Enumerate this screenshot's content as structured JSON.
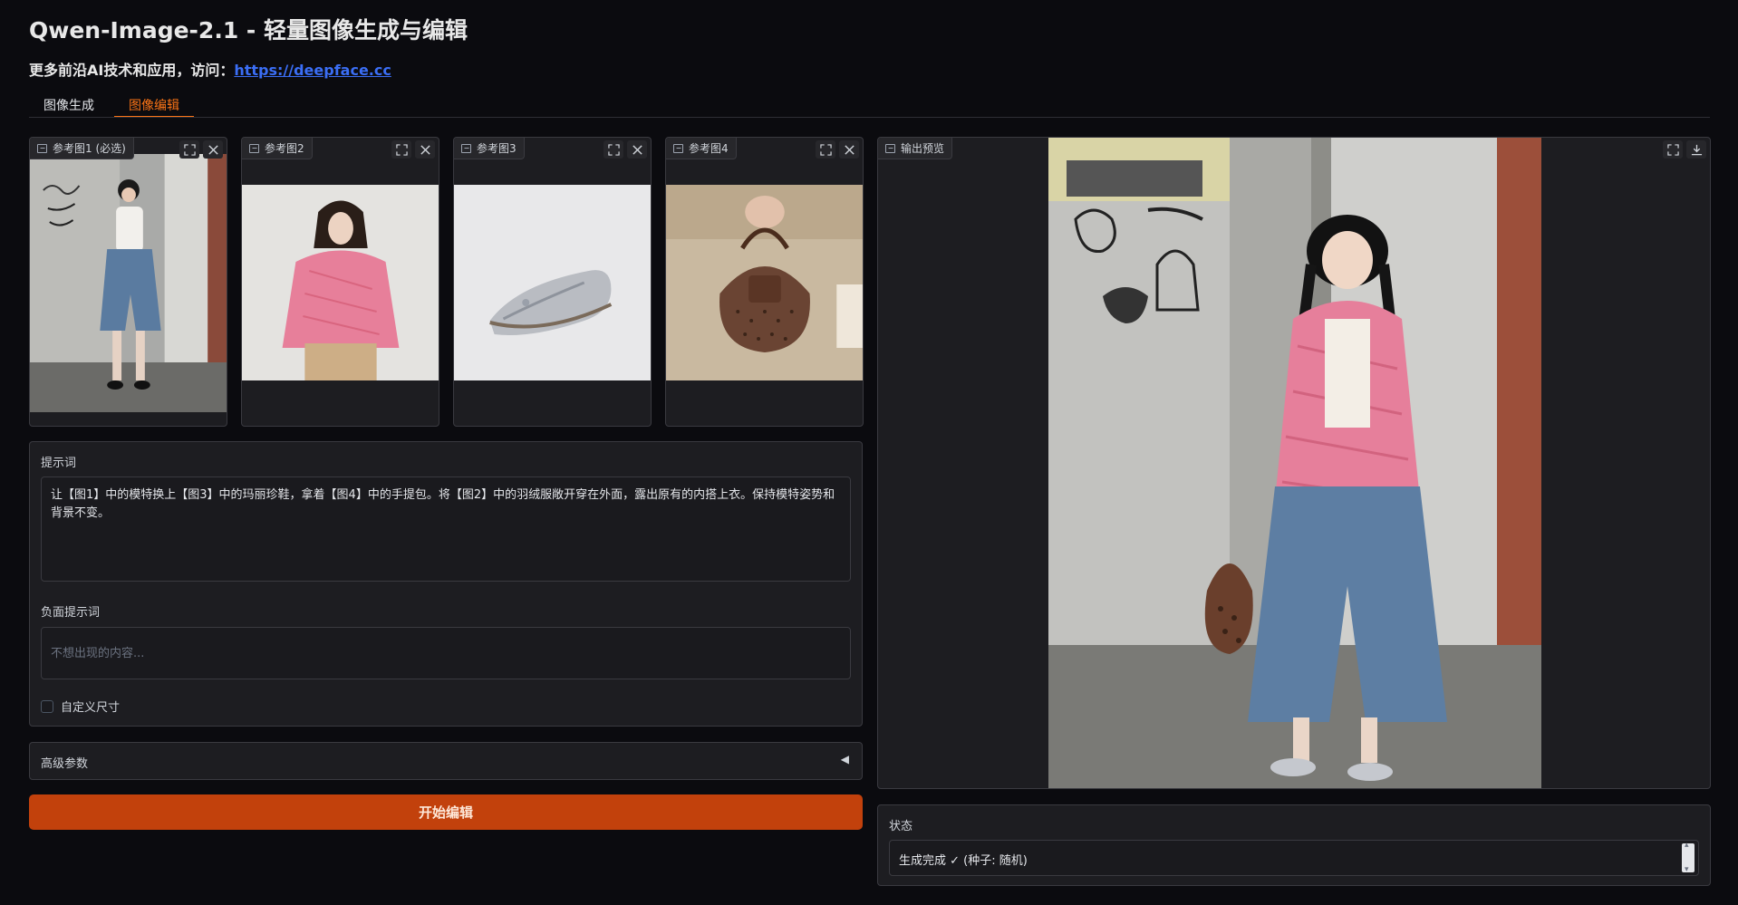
{
  "header": {
    "title": "Qwen-Image-2.1 - 轻量图像生成与编辑",
    "subtitle_prefix": "更多前沿AI技术和应用，访问：",
    "subtitle_link": "https://deepface.cc"
  },
  "tabs": [
    {
      "label": "图像生成",
      "active": false
    },
    {
      "label": "图像编辑",
      "active": true
    }
  ],
  "reference_images": [
    {
      "label": "参考图1 (必选)",
      "subject": "woman in white top and denim shorts by wall"
    },
    {
      "label": "参考图2",
      "subject": "woman in pink puffer jacket"
    },
    {
      "label": "参考图3",
      "subject": "silver Mary Jane shoe"
    },
    {
      "label": "参考图4",
      "subject": "brown polka-dot handbag"
    }
  ],
  "form": {
    "prompt_label": "提示词",
    "prompt_value": "让【图1】中的模特换上【图3】中的玛丽珍鞋，拿着【图4】中的手提包。将【图2】中的羽绒服敞开穿在外面，露出原有的内搭上衣。保持模特姿势和背景不变。",
    "negative_label": "负面提示词",
    "negative_placeholder": "不想出现的内容...",
    "custom_size_label": "自定义尺寸",
    "custom_size_checked": false
  },
  "advanced": {
    "label": "高级参数",
    "arrow": "◀"
  },
  "run_button": {
    "label": "开始编辑"
  },
  "output": {
    "label": "输出预览"
  },
  "status": {
    "label": "状态",
    "value": "生成完成 ✓ (种子: 随机)"
  },
  "colors": {
    "accent": "#f97316",
    "button": "#c2410c",
    "link": "#3b6ef5",
    "background": "#0b0b0f",
    "panel": "#1d1d21"
  }
}
